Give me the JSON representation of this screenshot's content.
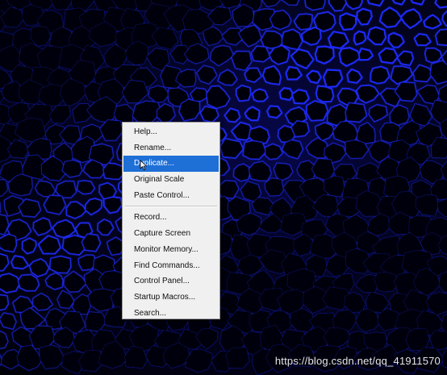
{
  "background": {
    "description_icon": "cell-micrograph-image",
    "cell_wall_color": "#1f2cff",
    "background_color": "#02020e"
  },
  "context_menu": {
    "items": [
      {
        "label": "Help...",
        "selected": false
      },
      {
        "label": "Rename...",
        "selected": false
      },
      {
        "label": "Duplicate...",
        "selected": true
      },
      {
        "label": "Original Scale",
        "selected": false
      },
      {
        "label": "Paste Control...",
        "selected": false
      },
      {
        "label": "Record...",
        "selected": false
      },
      {
        "label": "Capture Screen",
        "selected": false
      },
      {
        "label": "Monitor Memory...",
        "selected": false
      },
      {
        "label": "Find Commands...",
        "selected": false
      },
      {
        "label": "Control Panel...",
        "selected": false
      },
      {
        "label": "Startup Macros...",
        "selected": false
      },
      {
        "label": "Search...",
        "selected": false
      }
    ],
    "highlight_color": "#1e6fd6"
  },
  "watermark": {
    "text": "https://blog.csdn.net/qq_41911570"
  }
}
